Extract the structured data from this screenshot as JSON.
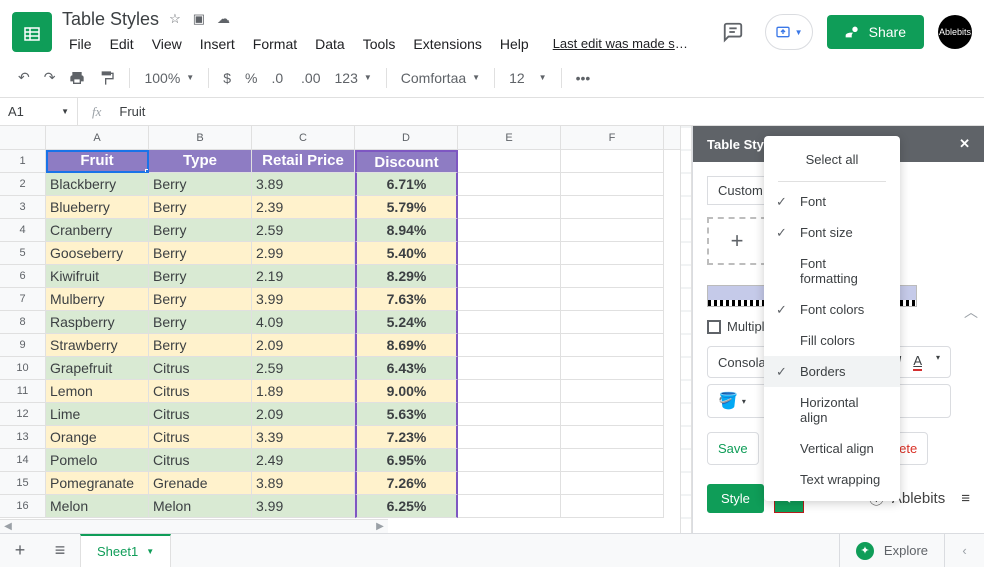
{
  "doc_title": "Table Styles",
  "menus": [
    "File",
    "Edit",
    "View",
    "Insert",
    "Format",
    "Data",
    "Tools",
    "Extensions",
    "Help"
  ],
  "last_edit": "Last edit was made se...",
  "share_label": "Share",
  "avatar_label": "Ablebits",
  "toolbar": {
    "zoom": "100%",
    "number_fmt": "123",
    "font_name": "Comfortaa",
    "font_size": "12"
  },
  "name_box": "A1",
  "formula": "Fruit",
  "columns": [
    "A",
    "B",
    "C",
    "D",
    "E",
    "F"
  ],
  "headers": [
    "Fruit",
    "Type",
    "Retail Price",
    "Discount"
  ],
  "rows": [
    {
      "n": "1"
    },
    {
      "n": "2",
      "cells": [
        "Blackberry",
        "Berry",
        "3.89",
        "6.71%"
      ]
    },
    {
      "n": "3",
      "cells": [
        "Blueberry",
        "Berry",
        "2.39",
        "5.79%"
      ]
    },
    {
      "n": "4",
      "cells": [
        "Cranberry",
        "Berry",
        "2.59",
        "8.94%"
      ]
    },
    {
      "n": "5",
      "cells": [
        "Gooseberry",
        "Berry",
        "2.99",
        "5.40%"
      ]
    },
    {
      "n": "6",
      "cells": [
        "Kiwifruit",
        "Berry",
        "2.19",
        "8.29%"
      ]
    },
    {
      "n": "7",
      "cells": [
        "Mulberry",
        "Berry",
        "3.99",
        "7.63%"
      ]
    },
    {
      "n": "8",
      "cells": [
        "Raspberry",
        "Berry",
        "4.09",
        "5.24%"
      ]
    },
    {
      "n": "9",
      "cells": [
        "Strawberry",
        "Berry",
        "2.09",
        "8.69%"
      ]
    },
    {
      "n": "10",
      "cells": [
        "Grapefruit",
        "Citrus",
        "2.59",
        "6.43%"
      ]
    },
    {
      "n": "11",
      "cells": [
        "Lemon",
        "Citrus",
        "1.89",
        "9.00%"
      ]
    },
    {
      "n": "12",
      "cells": [
        "Lime",
        "Citrus",
        "2.09",
        "5.63%"
      ]
    },
    {
      "n": "13",
      "cells": [
        "Orange",
        "Citrus",
        "3.39",
        "7.23%"
      ]
    },
    {
      "n": "14",
      "cells": [
        "Pomelo",
        "Citrus",
        "2.49",
        "6.95%"
      ]
    },
    {
      "n": "15",
      "cells": [
        "Pomegranate",
        "Grenade",
        "3.89",
        "7.26%"
      ]
    },
    {
      "n": "16",
      "cells": [
        "Melon",
        "Melon",
        "3.99",
        "6.25%"
      ]
    }
  ],
  "side": {
    "title": "Table Styles",
    "template_select": "Custom",
    "multiply": "Multipl",
    "font_preview": "Consolas",
    "save": "Save",
    "delete": "Delete",
    "style": "Style",
    "brand": "Ablebits"
  },
  "ctx": {
    "select_all": "Select all",
    "items": [
      {
        "label": "Font",
        "checked": true
      },
      {
        "label": "Font size",
        "checked": true
      },
      {
        "label": "Font formatting",
        "checked": false
      },
      {
        "label": "Font colors",
        "checked": true
      },
      {
        "label": "Fill colors",
        "checked": false
      },
      {
        "label": "Borders",
        "checked": true,
        "hover": true
      },
      {
        "label": "Horizontal align",
        "checked": false
      },
      {
        "label": "Vertical align",
        "checked": false
      },
      {
        "label": "Text wrapping",
        "checked": false
      }
    ]
  },
  "sheet_tab": "Sheet1",
  "explore": "Explore"
}
